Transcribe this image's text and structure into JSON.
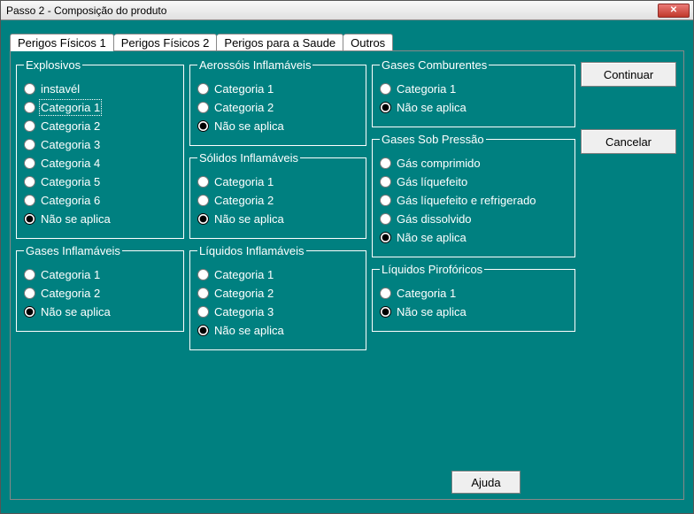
{
  "window": {
    "title": "Passo 2 - Composição do produto"
  },
  "tabs": [
    {
      "label": "Perigos Físicos 1",
      "active": true
    },
    {
      "label": "Perigos Físicos 2",
      "active": false
    },
    {
      "label": "Perigos para a Saude",
      "active": false
    },
    {
      "label": "Outros",
      "active": false
    }
  ],
  "buttons": {
    "continue": "Continuar",
    "cancel": "Cancelar",
    "help": "Ajuda"
  },
  "groups": {
    "explosivos": {
      "legend": "Explosivos",
      "options": [
        {
          "label": "instavél",
          "checked": false
        },
        {
          "label": "Categoria 1",
          "checked": false,
          "focused": true
        },
        {
          "label": "Categoria 2",
          "checked": false
        },
        {
          "label": "Categoria 3",
          "checked": false
        },
        {
          "label": "Categoria 4",
          "checked": false
        },
        {
          "label": "Categoria 5",
          "checked": false
        },
        {
          "label": "Categoria 6",
          "checked": false
        },
        {
          "label": "Não se aplica",
          "checked": true
        }
      ]
    },
    "gases_inflamaveis": {
      "legend": "Gases Inflamáveis",
      "options": [
        {
          "label": "Categoria 1",
          "checked": false
        },
        {
          "label": "Categoria 2",
          "checked": false
        },
        {
          "label": "Não se aplica",
          "checked": true
        }
      ]
    },
    "aerossois": {
      "legend": "Aerossóis Inflamáveis",
      "options": [
        {
          "label": "Categoria 1",
          "checked": false
        },
        {
          "label": "Categoria 2",
          "checked": false
        },
        {
          "label": "Não se aplica",
          "checked": true
        }
      ]
    },
    "solidos": {
      "legend": "Sólidos Inflamáveis",
      "options": [
        {
          "label": "Categoria 1",
          "checked": false
        },
        {
          "label": "Categoria 2",
          "checked": false
        },
        {
          "label": "Não se aplica",
          "checked": true
        }
      ]
    },
    "liquidos_inflamaveis": {
      "legend": "Líquidos Inflamáveis",
      "options": [
        {
          "label": "Categoria 1",
          "checked": false
        },
        {
          "label": "Categoria 2",
          "checked": false
        },
        {
          "label": "Categoria 3",
          "checked": false
        },
        {
          "label": "Não se aplica",
          "checked": true
        }
      ]
    },
    "gases_comburentes": {
      "legend": "Gases Comburentes",
      "options": [
        {
          "label": "Categoria 1",
          "checked": false
        },
        {
          "label": "Não se aplica",
          "checked": true
        }
      ]
    },
    "gases_pressao": {
      "legend": "Gases Sob Pressão",
      "options": [
        {
          "label": "Gás comprimido",
          "checked": false
        },
        {
          "label": "Gás líquefeito",
          "checked": false
        },
        {
          "label": "Gás líquefeito e refrigerado",
          "checked": false
        },
        {
          "label": "Gás dissolvido",
          "checked": false
        },
        {
          "label": "Não se aplica",
          "checked": true
        }
      ]
    },
    "liquidos_piroforicos": {
      "legend": "Líquidos Pirofóricos",
      "options": [
        {
          "label": "Categoria 1",
          "checked": false
        },
        {
          "label": "Não se aplica",
          "checked": true
        }
      ]
    }
  }
}
